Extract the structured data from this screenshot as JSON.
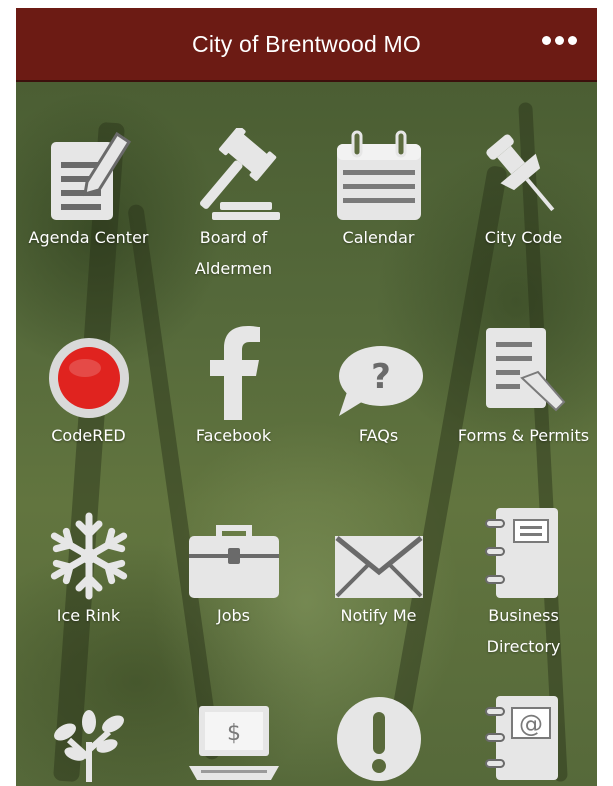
{
  "header": {
    "title": "City of Brentwood MO",
    "menu_icon": "more-dots-icon"
  },
  "colors": {
    "header_bg": "#6c1b14",
    "icon_fill": "#e6e6e6",
    "codered": "#e0231f"
  },
  "tiles": [
    {
      "label": "Agenda Center",
      "icon": "document-pencil-icon"
    },
    {
      "label": "Board of\nAldermen",
      "icon": "gavel-icon"
    },
    {
      "label": "Calendar",
      "icon": "calendar-icon"
    },
    {
      "label": "City Code",
      "icon": "pushpin-icon"
    },
    {
      "label": "CodeRED",
      "icon": "red-alert-button-icon"
    },
    {
      "label": "Facebook",
      "icon": "facebook-icon"
    },
    {
      "label": "FAQs",
      "icon": "question-bubble-icon"
    },
    {
      "label": "Forms & Permits",
      "icon": "form-pencil-icon"
    },
    {
      "label": "Ice Rink",
      "icon": "snowflake-icon"
    },
    {
      "label": "Jobs",
      "icon": "briefcase-icon"
    },
    {
      "label": "Notify Me",
      "icon": "envelope-icon"
    },
    {
      "label": "Business\nDirectory",
      "icon": "notebook-icon"
    },
    {
      "label": "",
      "icon": "tree-icon"
    },
    {
      "label": "",
      "icon": "laptop-dollar-icon"
    },
    {
      "label": "",
      "icon": "exclamation-icon"
    },
    {
      "label": "",
      "icon": "address-book-icon"
    }
  ]
}
